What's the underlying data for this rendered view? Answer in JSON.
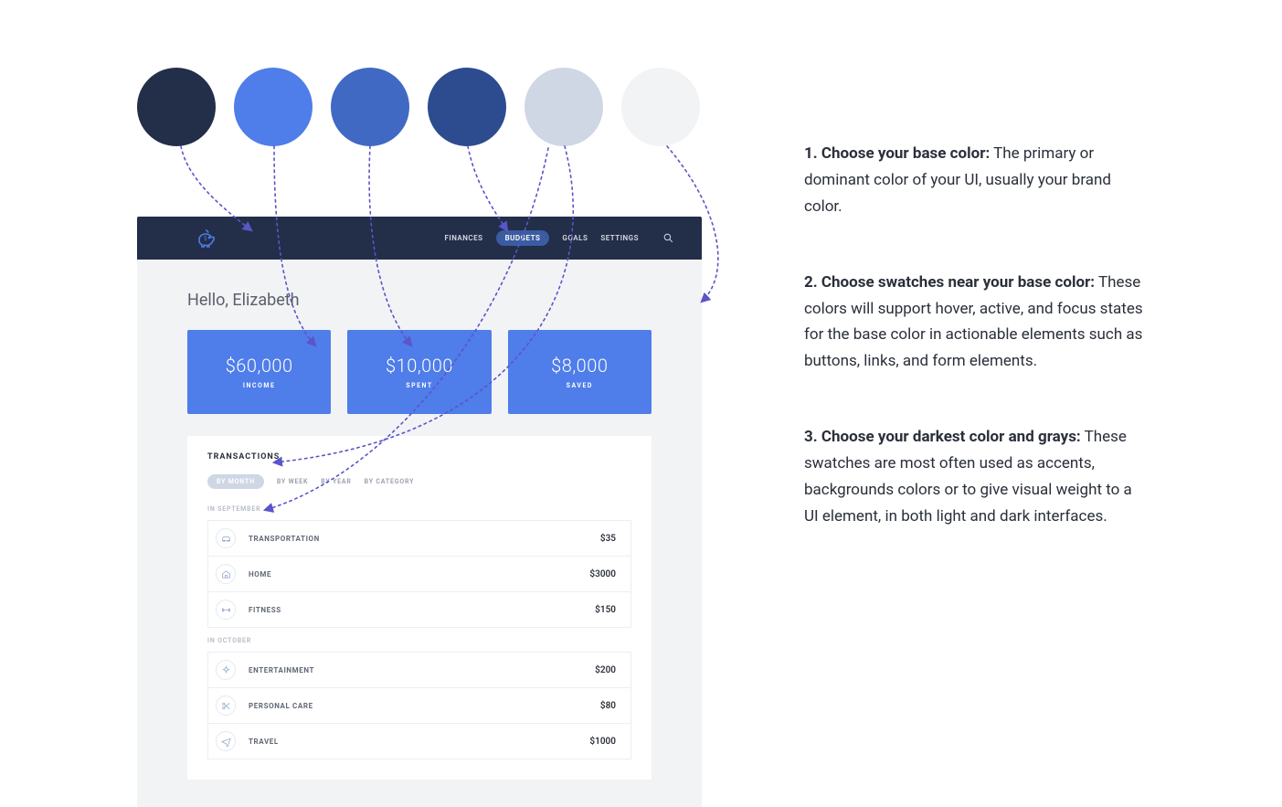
{
  "swatches": [
    {
      "name": "darkest",
      "hex": "#232e49"
    },
    {
      "name": "primary",
      "hex": "#4f7de9"
    },
    {
      "name": "shade-1",
      "hex": "#4069c4"
    },
    {
      "name": "shade-2",
      "hex": "#2d4b8f"
    },
    {
      "name": "gray",
      "hex": "#cfd7e4"
    },
    {
      "name": "lightest",
      "hex": "#f2f3f5"
    }
  ],
  "nav": {
    "items": [
      "FINANCES",
      "BUDGETS",
      "GOALS",
      "SETTINGS"
    ],
    "active_index": 1
  },
  "greeting": "Hello, Elizabeth",
  "summary": [
    {
      "amount": "$60,000",
      "label": "INCOME"
    },
    {
      "amount": "$10,000",
      "label": "SPENT"
    },
    {
      "amount": "$8,000",
      "label": "SAVED"
    }
  ],
  "transactions": {
    "title": "TRANSACTIONS",
    "filters": [
      "BY MONTH",
      "BY WEEK",
      "BY YEAR",
      "BY CATEGORY"
    ],
    "filter_active_index": 0,
    "groups": [
      {
        "label": "IN SEPTEMBER",
        "rows": [
          {
            "icon": "car-icon",
            "name": "TRANSPORTATION",
            "amount": "$35"
          },
          {
            "icon": "home-icon",
            "name": "HOME",
            "amount": "$3000"
          },
          {
            "icon": "fitness-icon",
            "name": "FITNESS",
            "amount": "$150"
          }
        ]
      },
      {
        "label": "IN OCTOBER",
        "rows": [
          {
            "icon": "sparkle-icon",
            "name": "ENTERTAINMENT",
            "amount": "$200"
          },
          {
            "icon": "scissors-icon",
            "name": "PERSONAL CARE",
            "amount": "$80"
          },
          {
            "icon": "plane-icon",
            "name": "TRAVEL",
            "amount": "$1000"
          }
        ]
      }
    ]
  },
  "steps": [
    {
      "title": "1. Choose your base color:",
      "body": "The primary or dominant color of your UI, usually your brand color."
    },
    {
      "title": "2. Choose swatches near your base color:",
      "body": "These colors will support hover, active, and focus states for the base color in actionable elements such as buttons, links, and form elements."
    },
    {
      "title": "3. Choose your darkest color and grays:",
      "body": "These swatches are most often used as accents, backgrounds colors or to give visual weight to a UI element, in both light and dark interfaces."
    }
  ],
  "arrow_color": "#5a55c9"
}
